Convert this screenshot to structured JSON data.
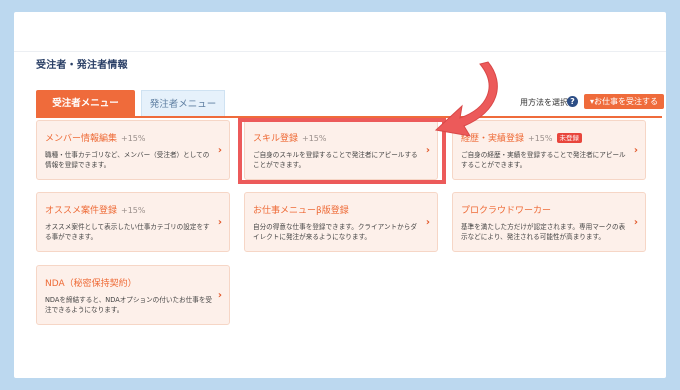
{
  "section_title": "受注者・発注者情報",
  "tabs": [
    {
      "label": "受注者メニュー",
      "active": true
    },
    {
      "label": "発注者メニュー",
      "active": false
    }
  ],
  "selector_text": "用方法を選択",
  "help_glyph": "?",
  "accept_button": "▾お仕事を受注する",
  "cards": [
    {
      "title": "メンバー情報編集",
      "rate": "+15%",
      "badge": "",
      "desc": "職種・仕事カテゴリなど、メンバー（受注者）としての情報を登録できます。",
      "arrow": "›"
    },
    {
      "title": "スキル登録",
      "rate": "+15%",
      "badge": "",
      "desc": "ご自身のスキルを登録することで発注者にアピールすることができます。",
      "arrow": "›"
    },
    {
      "title": "経歴・実績登録",
      "rate": "+15%",
      "badge": "未登録",
      "desc": "ご自身の経歴・実績を登録することで発注者にアピールすることができます。",
      "arrow": "›"
    },
    {
      "title": "オススメ案件登録",
      "rate": "+15%",
      "badge": "",
      "desc": "オススメ案件として表示したい仕事カテゴリの設定をする事ができます。",
      "arrow": "›"
    },
    {
      "title": "お仕事メニューβ版登録",
      "rate": "",
      "badge": "",
      "desc": "自分の得意な仕事を登録できます。クライアントからダイレクトに発注が来るようになります。",
      "arrow": "›"
    },
    {
      "title": "プロクラウドワーカー",
      "rate": "",
      "badge": "",
      "desc": "基準を満たした方だけが認定されます。専用マークの表示などにより、発注される可能性が高まります。",
      "arrow": "›"
    },
    {
      "title": "NDA（秘密保持契約）",
      "rate": "",
      "badge": "",
      "desc": "NDAを締結すると、NDAオプションの付いたお仕事を受注できるようになります。",
      "arrow": "›"
    }
  ],
  "colors": {
    "accent": "#ef6b3b",
    "highlight": "#ec5a5a",
    "background": "#bcd8ef"
  }
}
